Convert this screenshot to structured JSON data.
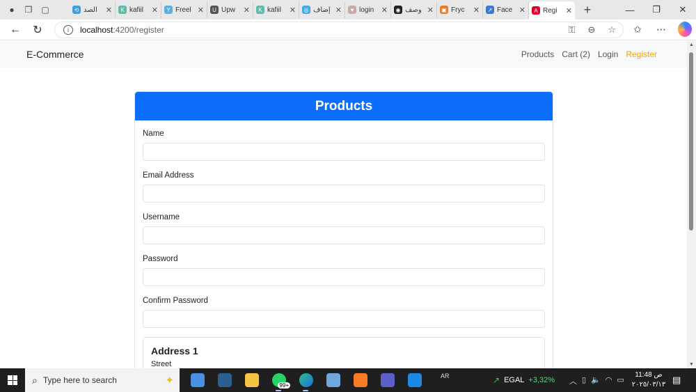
{
  "browser": {
    "tabs": [
      {
        "title": "الصد",
        "favicon_color": "#3fa0e0",
        "favicon": "⟲"
      },
      {
        "title": "kafiil",
        "favicon_color": "#5cbcaa",
        "favicon": "K"
      },
      {
        "title": "Freel",
        "favicon_color": "#5ab0e0",
        "favicon": "Y"
      },
      {
        "title": "Upw",
        "favicon_color": "#555555",
        "favicon": "U"
      },
      {
        "title": "kafiil",
        "favicon_color": "#5cbcaa",
        "favicon": "K"
      },
      {
        "title": "إضاف",
        "favicon_color": "#45a9e8",
        "favicon": "◎"
      },
      {
        "title": "login",
        "favicon_color": "#c9a9a9",
        "favicon": "♥"
      },
      {
        "title": "وصف",
        "favicon_color": "#222222",
        "favicon": "◉"
      },
      {
        "title": "Fryc",
        "favicon_color": "#e87b2a",
        "favicon": "▣"
      },
      {
        "title": "Face",
        "favicon_color": "#3a7bd5",
        "favicon": "↗"
      },
      {
        "title": "Regi",
        "favicon_color": "#dd0031",
        "favicon": "A",
        "active": true
      }
    ],
    "url_host": "localhost",
    "url_path": ":4200/register"
  },
  "navbar": {
    "brand": "E-Commerce",
    "links": [
      "Products",
      "Cart (2)",
      "Login",
      "Register"
    ],
    "active_link": "Register",
    "active_color": "#f0a500"
  },
  "card": {
    "header": "Products",
    "header_color": "#0d6efd",
    "fields": [
      {
        "label": "Name",
        "value": ""
      },
      {
        "label": "Email Address",
        "value": ""
      },
      {
        "label": "Username",
        "value": ""
      },
      {
        "label": "Password",
        "value": ""
      },
      {
        "label": "Confirm Password",
        "value": ""
      }
    ],
    "address_title": "Address 1",
    "street_label": "Street"
  },
  "taskbar": {
    "search_placeholder": "Type here to search",
    "whatsapp_badge": "99+",
    "lang": "AR",
    "stock_name": "EGAL",
    "stock_change": "+3,32%",
    "time": "11:48 ص",
    "date": "٢٠٢٥/٠٣/١٣"
  }
}
